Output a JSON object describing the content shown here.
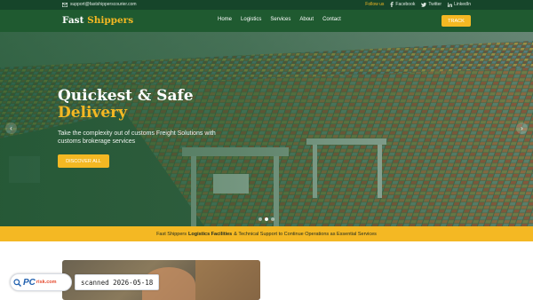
{
  "topbar": {
    "email": "support@fastshipperscourier.com",
    "follow_label": "Follow us",
    "social": [
      {
        "label": "Facebook",
        "icon": "facebook-icon"
      },
      {
        "label": "Twitter",
        "icon": "twitter-icon"
      },
      {
        "label": "LinkedIn",
        "icon": "linkedin-icon"
      }
    ]
  },
  "brand": {
    "name": "Fast",
    "accent": "Shippers"
  },
  "nav": {
    "items": [
      "Home",
      "Logistics",
      "Services",
      "About",
      "Contact"
    ],
    "track_label": "TRACK"
  },
  "hero": {
    "title_line1": "Quickest & Safe",
    "title_line2": "Delivery",
    "subtitle": "Take the complexity out of customs Freight Solutions with customs brokerage services",
    "cta_label": "DISCOVER ALL",
    "active_slide": 2,
    "slide_count": 3
  },
  "banner": {
    "prefix": "Fast Shippers",
    "bold": "Logistics Facilities",
    "suffix": "& Technical Support to Continue Operations as Essential Services"
  },
  "watermark": {
    "logo_text_pc": "PC",
    "logo_text_risk": "risk.com",
    "scan_label": "scanned 2026-05-18"
  },
  "colors": {
    "brand_green": "#1f5a30",
    "accent_yellow": "#f4b823",
    "topbar": "#16452a"
  }
}
